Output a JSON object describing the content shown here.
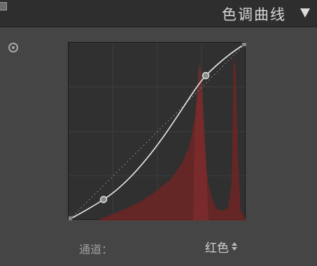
{
  "panel": {
    "title": "色调曲线",
    "collapse_icon": "triangle-down-icon",
    "toggle_icon": "panel-switch-icon",
    "target_tool_icon": "target-adjustment-icon"
  },
  "curve": {
    "channel_label": "通道：",
    "channel_value": "红色",
    "channel_selector_icon": "up-down-chevron-icon",
    "histogram_color": "#7a2a2a",
    "curve_color": "#e6e6e6",
    "grid_color": "#3c3c3c"
  }
}
